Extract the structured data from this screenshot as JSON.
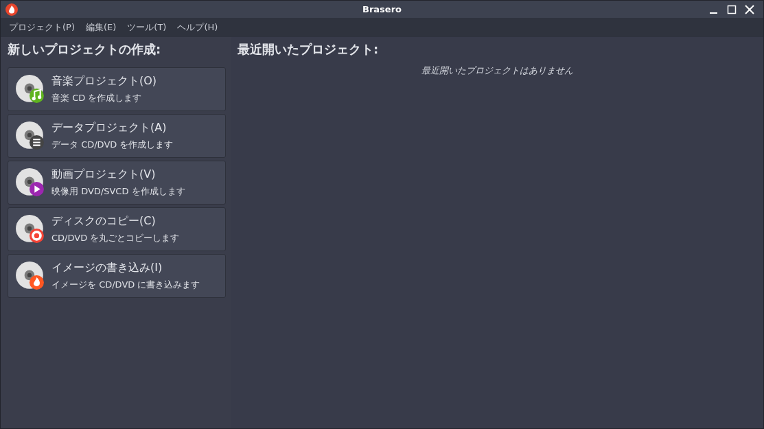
{
  "window": {
    "title": "Brasero"
  },
  "menu": [
    "プロジェクト(P)",
    "編集(E)",
    "ツール(T)",
    "ヘルプ(H)"
  ],
  "new_project": {
    "heading": "新しいプロジェクトの作成:",
    "items": [
      {
        "kind": "music",
        "title": "音楽プロジェクト(O)",
        "subtitle": "音楽 CD を作成します"
      },
      {
        "kind": "data",
        "title": "データプロジェクト(A)",
        "subtitle": "データ CD/DVD を作成します"
      },
      {
        "kind": "video",
        "title": "動画プロジェクト(V)",
        "subtitle": "映像用 DVD/SVCD を作成します"
      },
      {
        "kind": "copy",
        "title": "ディスクのコピー(C)",
        "subtitle": "CD/DVD を丸ごとコピーします"
      },
      {
        "kind": "burn",
        "title": "イメージの書き込み(I)",
        "subtitle": "イメージを CD/DVD に書き込みます"
      }
    ]
  },
  "recent": {
    "heading": "最近開いたプロジェクト:",
    "empty_message": "最近開いたプロジェクトはありません"
  }
}
